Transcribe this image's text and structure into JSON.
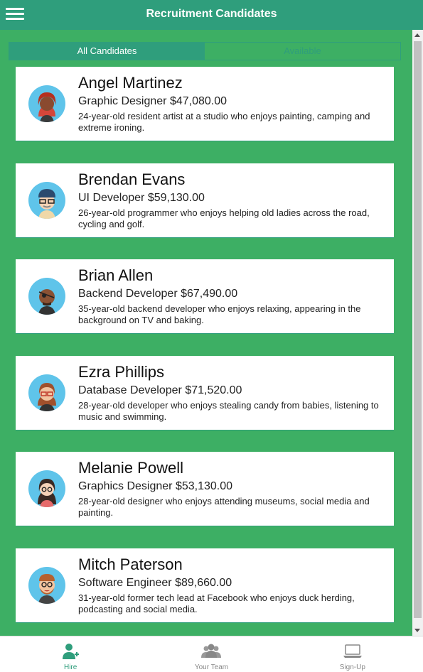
{
  "header": {
    "title": "Recruitment Candidates",
    "menu_icon": "hamburger-menu-icon"
  },
  "filter": {
    "all_label": "All Candidates",
    "available_label": "Available"
  },
  "candidates": [
    {
      "name": "Angel Martinez",
      "role": "Graphic Designer $47,080.00",
      "desc": "24-year-old resident artist at a studio who enjoys painting, camping and extreme ironing.",
      "avatar": "woman-red-hair-avatar"
    },
    {
      "name": "Brendan Evans",
      "role": "UI Developer $59,130.00",
      "desc": "26-year-old programmer who enjoys helping old ladies across the road, cycling and golf.",
      "avatar": "man-glasses-beanie-avatar"
    },
    {
      "name": "Brian Allen",
      "role": "Backend Developer $67,490.00",
      "desc": "35-year-old backend developer who enjoys relaxing, appearing in the background on TV and baking.",
      "avatar": "man-eyepatch-avatar"
    },
    {
      "name": "Ezra Phillips",
      "role": "Database Developer $71,520.00",
      "desc": "28-year-old developer who enjoys stealing candy from babies, listening to music and swimming.",
      "avatar": "woman-glasses-avatar"
    },
    {
      "name": "Melanie Powell",
      "role": "Graphics Designer $53,130.00",
      "desc": "28-year-old designer who enjoys attending museums, social media and painting.",
      "avatar": "woman-dark-hair-avatar"
    },
    {
      "name": "Mitch Paterson",
      "role": "Software Engineer $89,660.00",
      "desc": "31-year-old former tech lead at Facebook who enjoys duck herding, podcasting and social media.",
      "avatar": "man-beard-glasses-avatar"
    }
  ],
  "tabs": [
    {
      "label": "Hire",
      "icon": "add-person-icon"
    },
    {
      "label": "Your Team",
      "icon": "team-icon"
    },
    {
      "label": "Sign-Up",
      "icon": "laptop-icon"
    }
  ],
  "colors": {
    "header": "#2f9e7c",
    "background": "#3daf64",
    "card": "#ffffff",
    "accent": "#2f9e7c"
  }
}
